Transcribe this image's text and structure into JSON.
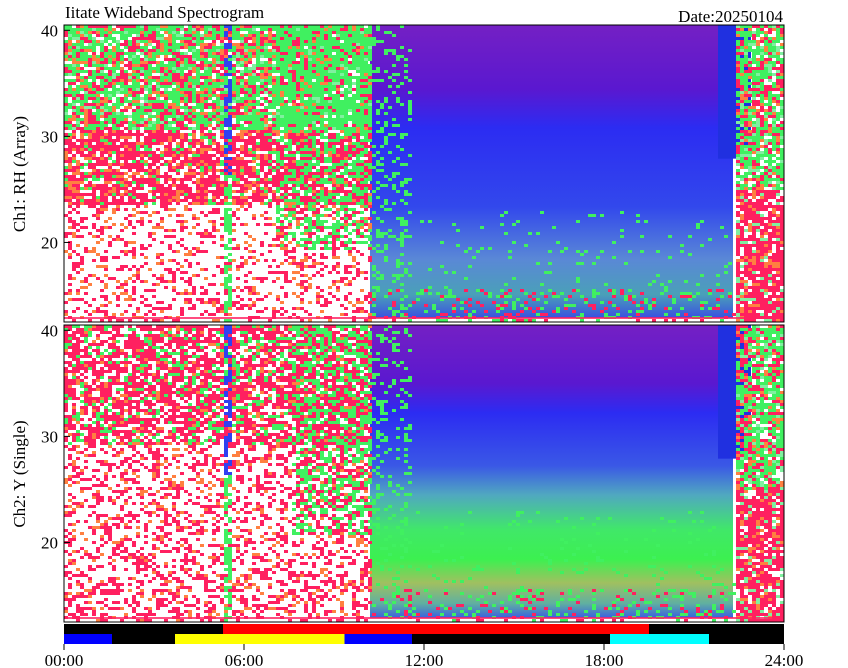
{
  "title": "Iitate Wideband Spectrogram",
  "date_label": "Date:20250104",
  "chart_data": [
    {
      "type": "heatmap",
      "ylabel": "Ch1: RH (Array)",
      "ylim": [
        12.5,
        40.5
      ],
      "yticks": [
        20,
        30,
        40
      ],
      "xlim": [
        0,
        24
      ],
      "description_bands": [
        {
          "from_h": 0,
          "to_h": 5.2,
          "dominant": "noise-white-red"
        },
        {
          "from_h": 5.2,
          "to_h": 5.6,
          "dominant": "green-blue"
        },
        {
          "from_h": 5.6,
          "to_h": 10,
          "dominant": "noise-red-green"
        },
        {
          "from_h": 10,
          "to_h": 22.5,
          "dominant": "quiet-blue-purple"
        },
        {
          "from_h": 22.5,
          "to_h": 24,
          "dominant": "noise-green-red"
        }
      ]
    },
    {
      "type": "heatmap",
      "ylabel": "Ch2: Y (Single)",
      "ylim": [
        12.5,
        40.5
      ],
      "yticks": [
        20,
        30,
        40
      ],
      "xlim": [
        0,
        24
      ],
      "description_bands": [
        {
          "from_h": 0,
          "to_h": 10,
          "dominant": "noise-white-red"
        },
        {
          "from_h": 10,
          "to_h": 22.5,
          "dominant": "quiet-blue-purple-green"
        },
        {
          "from_h": 22.5,
          "to_h": 24,
          "dominant": "noise-green-red"
        }
      ]
    }
  ],
  "xticks": [
    "00:00",
    "06:00",
    "12:00",
    "18:00",
    "24:00"
  ],
  "xtick_hours": [
    0,
    6,
    12,
    18,
    24
  ],
  "status_bar": {
    "top": [
      {
        "from_h": 0,
        "to_h": 5.3,
        "color": "#000000"
      },
      {
        "from_h": 5.3,
        "to_h": 19.5,
        "color": "#ff0000"
      },
      {
        "from_h": 19.5,
        "to_h": 24,
        "color": "#000000"
      }
    ],
    "bottom": [
      {
        "from_h": 0,
        "to_h": 1.6,
        "color": "#0000ff"
      },
      {
        "from_h": 1.6,
        "to_h": 3.7,
        "color": "#000000"
      },
      {
        "from_h": 3.7,
        "to_h": 9.35,
        "color": "#ffff00"
      },
      {
        "from_h": 9.35,
        "to_h": 11.6,
        "color": "#0000ff"
      },
      {
        "from_h": 11.6,
        "to_h": 18.2,
        "color": "#000000"
      },
      {
        "from_h": 18.2,
        "to_h": 21.5,
        "color": "#00ffff"
      },
      {
        "from_h": 21.5,
        "to_h": 24,
        "color": "#000000"
      }
    ]
  },
  "colors": {
    "white": "#ffffff",
    "red": "#ff2060",
    "orange": "#ff8040",
    "yellow": "#f0f040",
    "green": "#40f060",
    "lightgreen": "#80f0a0",
    "blue": "#3040f0",
    "darkblue": "#2030e0",
    "purple": "#7020c0"
  }
}
